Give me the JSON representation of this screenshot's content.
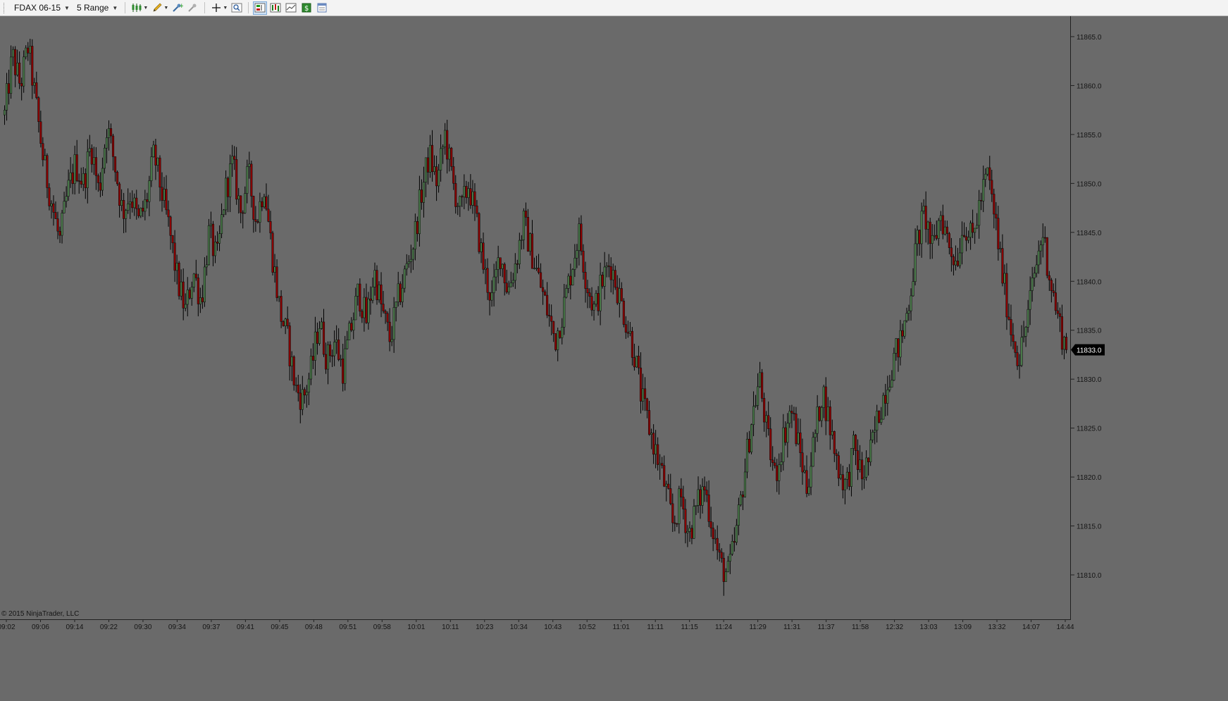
{
  "toolbar": {
    "instrument": "FDAX 06-15",
    "period": "5 Range",
    "icons": [
      "candlestick-chart-icon",
      "pencil-draw-icon",
      "add-indicator-icon",
      "remove-indicator-icon",
      "crosshair-icon",
      "zoom-icon",
      "chart-trader-icon",
      "strategy-icon",
      "data-box-icon",
      "currency-icon",
      "properties-icon"
    ]
  },
  "colors": {
    "background": "#6a6a6a",
    "up_candle": "#4a7a4a",
    "down_candle": "#8b0000",
    "wick": "#000000",
    "price_marker_bg": "#000000",
    "price_marker_text": "#ffffff"
  },
  "copyright": "© 2015 NinjaTrader, LLC",
  "chart_data": {
    "type": "candlestick",
    "instrument": "FDAX 06-15",
    "bar_type": "5 Range",
    "ylim": [
      11806.0,
      11867.0
    ],
    "y_ticks": [
      "11865.0",
      "11860.0",
      "11855.0",
      "11850.0",
      "11845.0",
      "11840.0",
      "11835.0",
      "11830.0",
      "11825.0",
      "11820.0",
      "11815.0",
      "11810.0"
    ],
    "x_ticks": [
      "09:02",
      "09:06",
      "09:14",
      "09:22",
      "09:30",
      "09:34",
      "09:37",
      "09:41",
      "09:45",
      "09:48",
      "09:51",
      "09:58",
      "10:01",
      "10:11",
      "10:23",
      "10:34",
      "10:43",
      "10:52",
      "11:01",
      "11:11",
      "11:15",
      "11:24",
      "11:29",
      "11:31",
      "11:37",
      "11:58",
      "12:32",
      "13:03",
      "13:09",
      "13:32",
      "14:07",
      "14:44"
    ],
    "last_price": "11833.0",
    "close_path": [
      [
        0,
        11857
      ],
      [
        2,
        11863
      ],
      [
        4,
        11860
      ],
      [
        6,
        11864
      ],
      [
        8,
        11858
      ],
      [
        10,
        11852
      ],
      [
        12,
        11848
      ],
      [
        14,
        11844
      ],
      [
        16,
        11849
      ],
      [
        18,
        11852
      ],
      [
        20,
        11850
      ],
      [
        22,
        11854
      ],
      [
        24,
        11849
      ],
      [
        26,
        11856
      ],
      [
        28,
        11852
      ],
      [
        30,
        11847
      ],
      [
        32,
        11849
      ],
      [
        34,
        11846
      ],
      [
        36,
        11848
      ],
      [
        38,
        11853
      ],
      [
        40,
        11849
      ],
      [
        42,
        11845
      ],
      [
        44,
        11840
      ],
      [
        46,
        11837
      ],
      [
        48,
        11841
      ],
      [
        50,
        11838
      ],
      [
        52,
        11845
      ],
      [
        54,
        11842
      ],
      [
        56,
        11849
      ],
      [
        58,
        11852
      ],
      [
        60,
        11847
      ],
      [
        62,
        11851
      ],
      [
        64,
        11846
      ],
      [
        66,
        11850
      ],
      [
        68,
        11843
      ],
      [
        70,
        11837
      ],
      [
        72,
        11834
      ],
      [
        74,
        11829
      ],
      [
        76,
        11828
      ],
      [
        78,
        11831
      ],
      [
        80,
        11836
      ],
      [
        82,
        11832
      ],
      [
        84,
        11834
      ],
      [
        86,
        11831
      ],
      [
        88,
        11835
      ],
      [
        90,
        11839
      ],
      [
        92,
        11836
      ],
      [
        94,
        11841
      ],
      [
        96,
        11837
      ],
      [
        98,
        11834
      ],
      [
        100,
        11838
      ],
      [
        102,
        11841
      ],
      [
        104,
        11844
      ],
      [
        106,
        11849
      ],
      [
        108,
        11853
      ],
      [
        110,
        11850
      ],
      [
        112,
        11855
      ],
      [
        114,
        11850
      ],
      [
        116,
        11847
      ],
      [
        118,
        11850
      ],
      [
        120,
        11846
      ],
      [
        122,
        11841
      ],
      [
        124,
        11838
      ],
      [
        126,
        11843
      ],
      [
        128,
        11839
      ],
      [
        130,
        11842
      ],
      [
        132,
        11846
      ],
      [
        134,
        11843
      ],
      [
        136,
        11840
      ],
      [
        138,
        11837
      ],
      [
        140,
        11834
      ],
      [
        142,
        11837
      ],
      [
        144,
        11841
      ],
      [
        146,
        11845
      ],
      [
        148,
        11840
      ],
      [
        150,
        11837
      ],
      [
        152,
        11840
      ],
      [
        154,
        11842
      ],
      [
        156,
        11839
      ],
      [
        158,
        11836
      ],
      [
        160,
        11833
      ],
      [
        162,
        11828
      ],
      [
        164,
        11825
      ],
      [
        166,
        11822
      ],
      [
        168,
        11819
      ],
      [
        170,
        11815
      ],
      [
        172,
        11818
      ],
      [
        174,
        11814
      ],
      [
        176,
        11817
      ],
      [
        178,
        11819
      ],
      [
        180,
        11815
      ],
      [
        182,
        11811
      ],
      [
        184,
        11810
      ],
      [
        186,
        11814
      ],
      [
        188,
        11820
      ],
      [
        190,
        11826
      ],
      [
        192,
        11830
      ],
      [
        194,
        11824
      ],
      [
        196,
        11820
      ],
      [
        198,
        11824
      ],
      [
        200,
        11827
      ],
      [
        202,
        11823
      ],
      [
        204,
        11819
      ],
      [
        206,
        11824
      ],
      [
        208,
        11829
      ],
      [
        210,
        11825
      ],
      [
        212,
        11821
      ],
      [
        214,
        11819
      ],
      [
        216,
        11823
      ],
      [
        218,
        11820
      ],
      [
        220,
        11822
      ],
      [
        222,
        11826
      ],
      [
        224,
        11829
      ],
      [
        226,
        11832
      ],
      [
        228,
        11834
      ],
      [
        230,
        11838
      ],
      [
        232,
        11844
      ],
      [
        234,
        11847
      ],
      [
        236,
        11843
      ],
      [
        238,
        11847
      ],
      [
        240,
        11844
      ],
      [
        242,
        11842
      ],
      [
        244,
        11846
      ],
      [
        246,
        11844
      ],
      [
        248,
        11848
      ],
      [
        250,
        11851
      ],
      [
        252,
        11846
      ],
      [
        254,
        11840
      ],
      [
        256,
        11835
      ],
      [
        258,
        11832
      ],
      [
        260,
        11836
      ],
      [
        262,
        11841
      ],
      [
        264,
        11845
      ],
      [
        266,
        11840
      ],
      [
        268,
        11836
      ],
      [
        270,
        11833
      ]
    ]
  }
}
